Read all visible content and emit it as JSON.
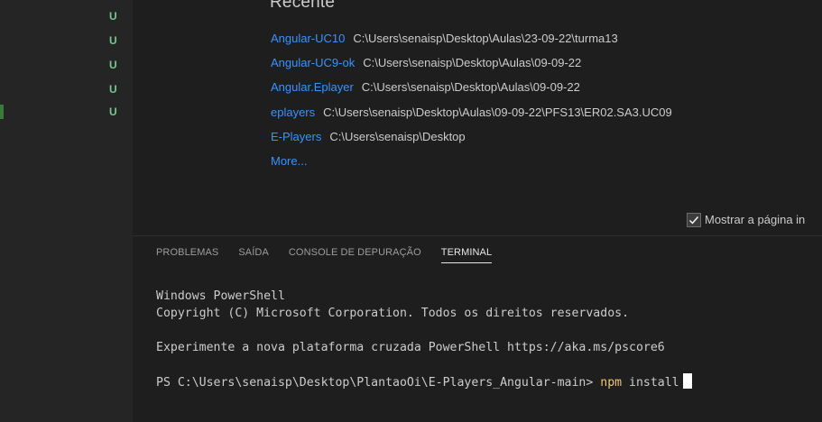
{
  "sidebar": {
    "git_status_marks": [
      "U",
      "U",
      "U",
      "U",
      "U"
    ]
  },
  "welcome": {
    "recent_heading": "Recente",
    "recent": [
      {
        "name": "Angular-UC10",
        "path": "C:\\Users\\senaisp\\Desktop\\Aulas\\23-09-22\\turma13"
      },
      {
        "name": "Angular-UC9-ok",
        "path": "C:\\Users\\senaisp\\Desktop\\Aulas\\09-09-22"
      },
      {
        "name": "Angular.Eplayer",
        "path": "C:\\Users\\senaisp\\Desktop\\Aulas\\09-09-22"
      },
      {
        "name": "eplayers",
        "path": "C:\\Users\\senaisp\\Desktop\\Aulas\\09-09-22\\PFS13\\ER02.SA3.UC09"
      },
      {
        "name": "E-Players",
        "path": "C:\\Users\\senaisp\\Desktop"
      }
    ],
    "more_label": "More...",
    "show_welcome_label": "Mostrar a página in",
    "show_welcome_checked": true
  },
  "panel": {
    "tabs": [
      {
        "label": "PROBLEMAS",
        "active": false
      },
      {
        "label": "SAÍDA",
        "active": false
      },
      {
        "label": "CONSOLE DE DEPURAÇÃO",
        "active": false
      },
      {
        "label": "TERMINAL",
        "active": true
      }
    ],
    "terminal": {
      "line1": "Windows PowerShell",
      "line2": "Copyright (C) Microsoft Corporation. Todos os direitos reservados.",
      "line3": "Experimente a nova plataforma cruzada PowerShell https://aka.ms/pscore6",
      "prompt": "PS C:\\Users\\senaisp\\Desktop\\PlantaoOi\\E-Players_Angular-main> ",
      "command": "npm",
      "args": " install"
    }
  },
  "colors": {
    "link": "#3794ff",
    "git_untracked": "#73c991",
    "command": "#f0c674"
  }
}
